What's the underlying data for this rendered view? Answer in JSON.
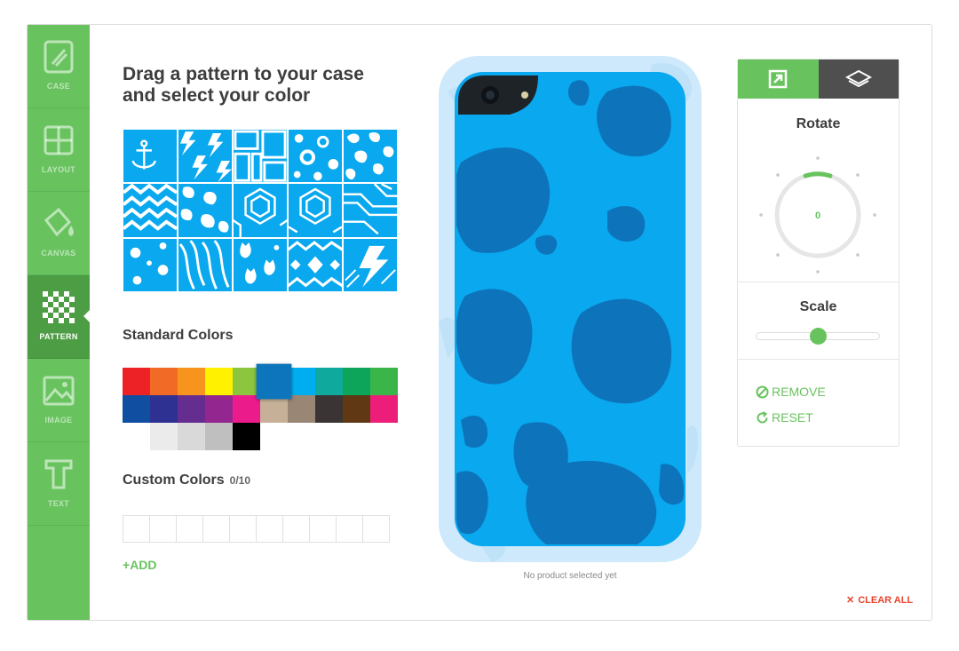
{
  "sidebar": {
    "items": [
      {
        "label": "CASE",
        "icon": "case-icon"
      },
      {
        "label": "LAYOUT",
        "icon": "layout-icon"
      },
      {
        "label": "CANVAS",
        "icon": "paint-bucket-icon"
      },
      {
        "label": "PATTERN",
        "icon": "checker-pattern-icon"
      },
      {
        "label": "IMAGE",
        "icon": "image-icon"
      },
      {
        "label": "TEXT",
        "icon": "text-icon"
      }
    ],
    "active": "PATTERN"
  },
  "main": {
    "heading_line1": "Drag a pattern to your case",
    "heading_line2": "and select your color",
    "patterns": [
      "anchor",
      "lightning",
      "bricks",
      "bubbles",
      "leopard",
      "chevron",
      "splotches",
      "hexagons",
      "hexagons-2",
      "geometric-lines",
      "polka-dots",
      "zebra",
      "cats",
      "diamonds",
      "lightning-2"
    ],
    "standard_colors_title": "Standard Colors",
    "standard_colors": [
      [
        "#ec2227",
        "#f26b26",
        "#f7941d",
        "#fff100",
        "#8cc63f",
        "#0d75bb",
        "#00aeef",
        "#0fa99d",
        "#0da55a",
        "#39b54a"
      ],
      [
        "#0f4ea0",
        "#2e3192",
        "#662d91",
        "#93278f",
        "#ec1b8c",
        "#c6b198",
        "#998675",
        "#3a3435",
        "#603813",
        "#ed1e79"
      ],
      [
        "#ffffff",
        "#ebebeb",
        "#d9d9d9",
        "#bfbfbf",
        "#000000"
      ]
    ],
    "selected_color": "#0d75bb",
    "custom_colors_title": "Custom Colors",
    "custom_colors_count": "0/10",
    "add_label": "ADD"
  },
  "preview": {
    "case_color": "#0aa8ee",
    "spot_color": "#0d74bb",
    "status": "No product selected yet"
  },
  "controls": {
    "rotate_label": "Rotate",
    "rotate_value": "0",
    "scale_label": "Scale",
    "scale_value": 0.5,
    "remove_label": "REMOVE",
    "reset_label": "RESET"
  },
  "clear_all_label": "CLEAR ALL",
  "colors": {
    "accent": "#68c35f",
    "danger": "#e8442c"
  }
}
